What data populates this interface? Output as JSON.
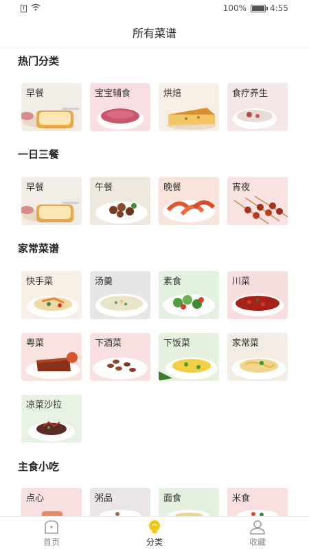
{
  "status_bar": {
    "battery": "100%",
    "time": "4:55"
  },
  "header": {
    "title": "所有菜谱"
  },
  "sections": [
    {
      "title": "热门分类",
      "items": [
        {
          "label": "早餐",
          "icon": "toast-bread"
        },
        {
          "label": "宝宝辅食",
          "icon": "pink-porridge"
        },
        {
          "label": "烘焙",
          "icon": "cake-slice"
        },
        {
          "label": "食疗养生",
          "icon": "soup-bowl"
        }
      ]
    },
    {
      "title": "一日三餐",
      "items": [
        {
          "label": "早餐",
          "icon": "toast-bread"
        },
        {
          "label": "午餐",
          "icon": "braised-meat"
        },
        {
          "label": "晚餐",
          "icon": "shrimp-plate"
        },
        {
          "label": "宵夜",
          "icon": "skewers"
        }
      ]
    },
    {
      "title": "家常菜谱",
      "items": [
        {
          "label": "快手菜",
          "icon": "noodle-salad"
        },
        {
          "label": "汤羹",
          "icon": "egg-soup"
        },
        {
          "label": "素食",
          "icon": "green-salad"
        },
        {
          "label": "川菜",
          "icon": "chili-chicken"
        },
        {
          "label": "粤菜",
          "icon": "roast-duck"
        },
        {
          "label": "下酒菜",
          "icon": "peanuts"
        },
        {
          "label": "下饭菜",
          "icon": "egg-stirfry"
        },
        {
          "label": "家常菜",
          "icon": "pasta"
        },
        {
          "label": "凉菜沙拉",
          "icon": "cold-salad"
        }
      ]
    },
    {
      "title": "主食小吃",
      "items": [
        {
          "label": "点心",
          "icon": "dim-sum"
        },
        {
          "label": "粥品",
          "icon": "congee"
        },
        {
          "label": "面食",
          "icon": "noodles"
        },
        {
          "label": "米食",
          "icon": "fried-rice"
        }
      ]
    }
  ],
  "bottom_nav": [
    {
      "label": "首页",
      "icon": "home-icon",
      "active": false
    },
    {
      "label": "分类",
      "icon": "bulb-icon",
      "active": true
    },
    {
      "label": "收藏",
      "icon": "user-icon",
      "active": false
    }
  ],
  "colors": {
    "active_accent": "#f5c518",
    "inactive": "#9a9a9a"
  }
}
